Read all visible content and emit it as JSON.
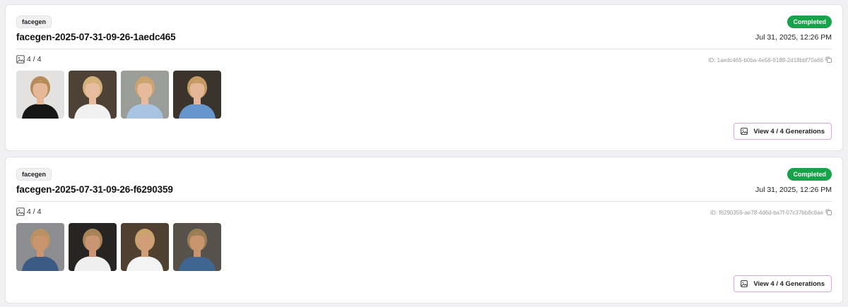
{
  "generations": [
    {
      "tag": "facegen",
      "status": "Completed",
      "title": "facegen-2025-07-31-09-26-1aedc465",
      "date": "Jul 31, 2025, 12:26 PM",
      "count": "4 / 4",
      "id_text": "ID: 1aedc465-b0ba-4e56-9188-2d18bbf70a66",
      "view_label": "View 4 / 4 Generations",
      "thumbnails": [
        {
          "name": "blonde woman black sports top",
          "bg": "#e3e2e0",
          "skin": "#e6b899",
          "hair": "#b88a55",
          "shirt": "#161616"
        },
        {
          "name": "blonde woman white tee",
          "bg": "#4e4236",
          "skin": "#e8bd9f",
          "hair": "#d2b07a",
          "shirt": "#f1f1f1"
        },
        {
          "name": "blonde woman blue denim shirt",
          "bg": "#9b9d98",
          "skin": "#e6bb9c",
          "hair": "#c9a46e",
          "shirt": "#a9c3e2"
        },
        {
          "name": "blonde woman blue tee",
          "bg": "#3b342d",
          "skin": "#e4b697",
          "hair": "#c49a62",
          "shirt": "#6796cf"
        }
      ]
    },
    {
      "tag": "facegen",
      "status": "Completed",
      "title": "facegen-2025-07-31-09-26-f6290359",
      "date": "Jul 31, 2025, 12:26 PM",
      "count": "4 / 4",
      "id_text": "ID: f6290359-ae78-4d6d-ba7f-07c37bb8c8ae",
      "view_label": "View 4 / 4 Generations",
      "thumbnails": [
        {
          "name": "man denim vest",
          "bg": "#8c8d90",
          "skin": "#c9946e",
          "hair": "#b99162",
          "shirt": "#3b5b84"
        },
        {
          "name": "man white tee dark background",
          "bg": "#262524",
          "skin": "#c99572",
          "hair": "#a78458",
          "shirt": "#efefef"
        },
        {
          "name": "man white tank top",
          "bg": "#50402f",
          "skin": "#cf9d77",
          "hair": "#c9a26c",
          "shirt": "#f3f3f3"
        },
        {
          "name": "man blue tee",
          "bg": "#56524b",
          "skin": "#c99470",
          "hair": "#9b7d55",
          "shirt": "#3e6691"
        }
      ]
    }
  ]
}
